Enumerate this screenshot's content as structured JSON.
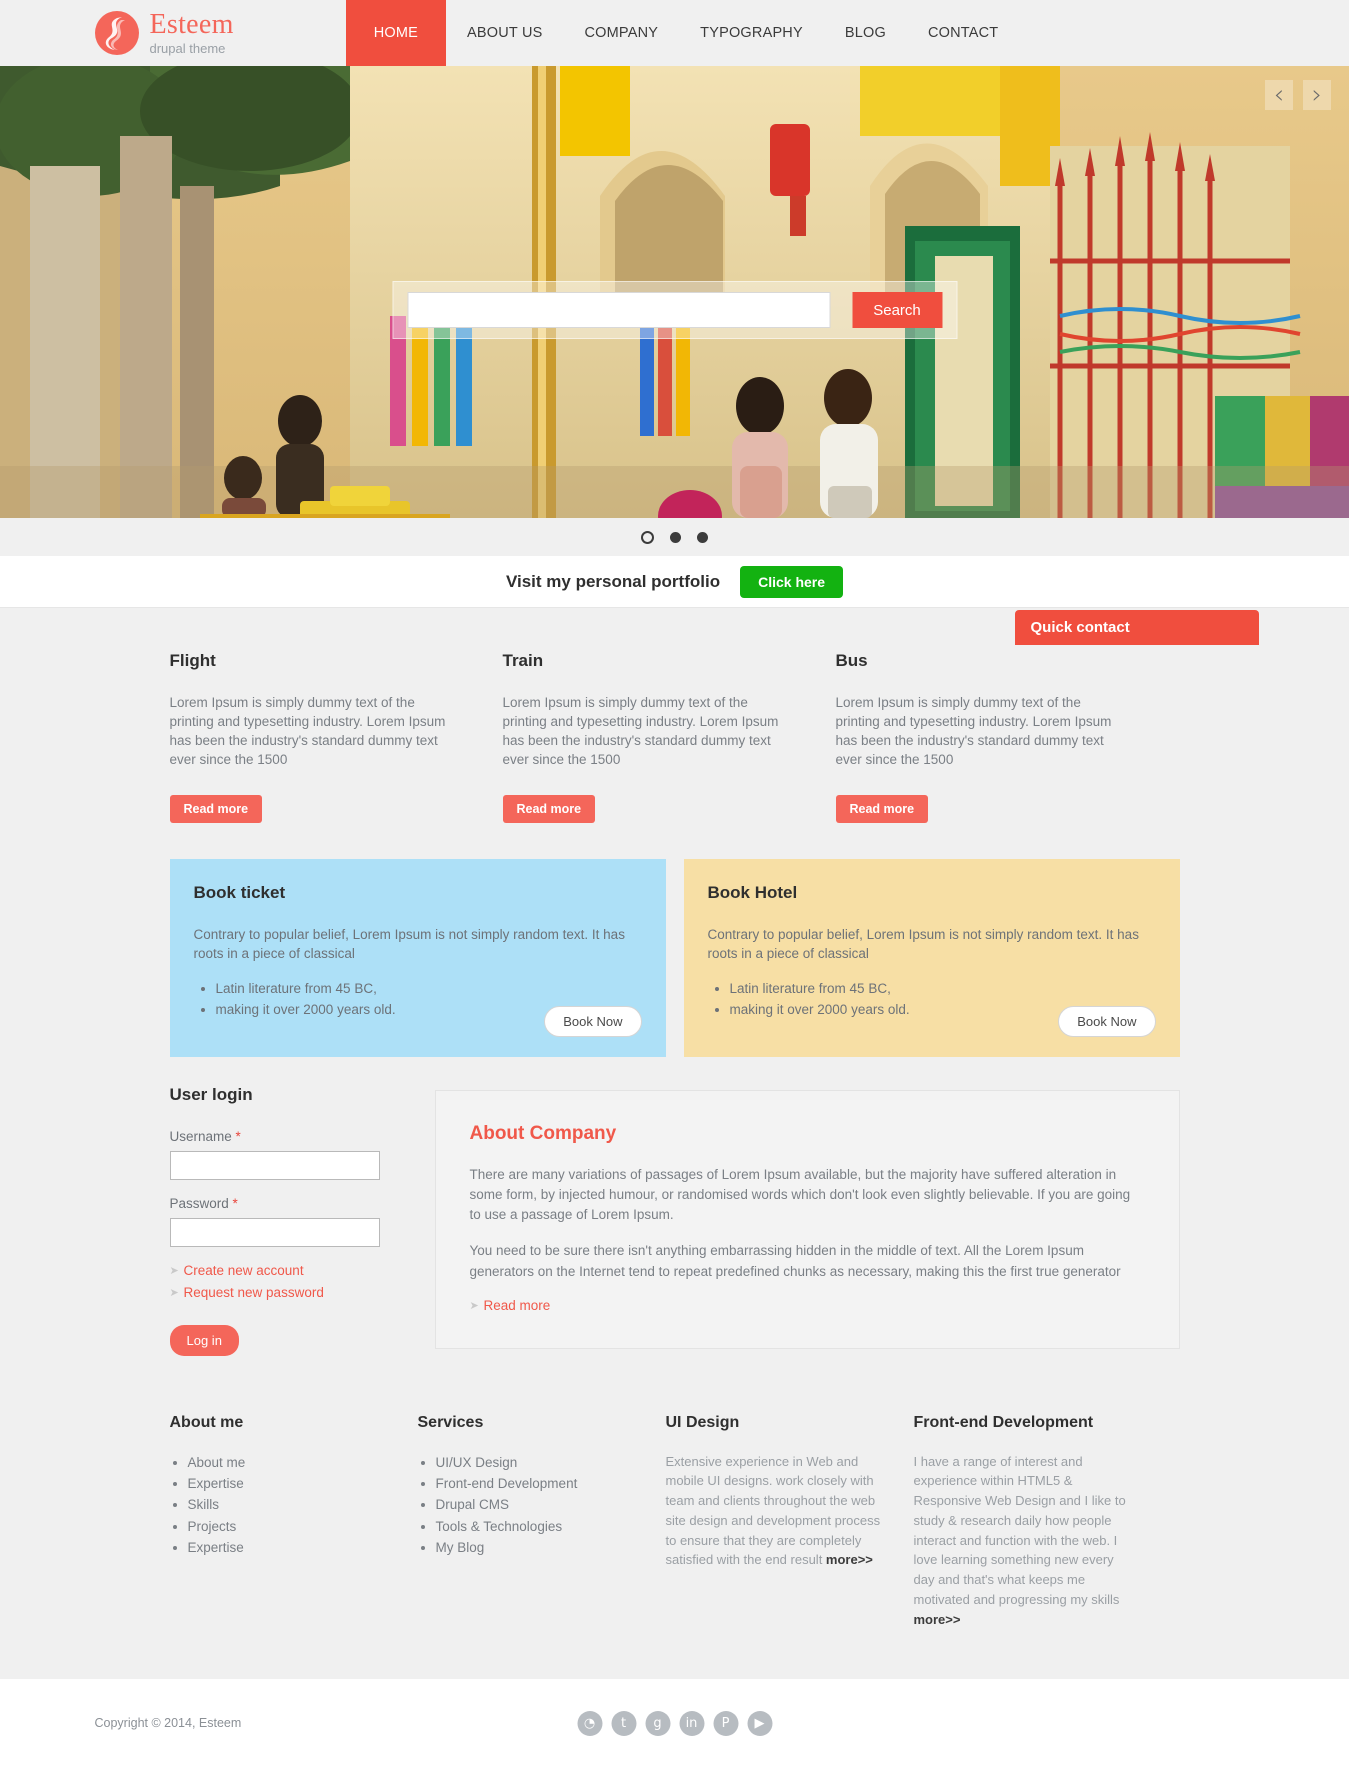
{
  "header": {
    "brand_name": "Esteem",
    "brand_sub": "drupal theme",
    "nav": [
      {
        "label": "HOME",
        "active": true
      },
      {
        "label": "ABOUT US",
        "active": false
      },
      {
        "label": "COMPANY",
        "active": false
      },
      {
        "label": "TYPOGRAPHY",
        "active": false
      },
      {
        "label": "BLOG",
        "active": false
      },
      {
        "label": "CONTACT",
        "active": false
      }
    ]
  },
  "slider": {
    "prev_glyph": "‹",
    "next_glyph": "›",
    "search_value": "",
    "search_placeholder": "",
    "search_button": "Search",
    "dots": [
      {
        "active": true
      },
      {
        "active": false
      },
      {
        "active": false
      }
    ]
  },
  "portfolio": {
    "text": "Visit my personal portfolio",
    "button": "Click here",
    "button_color": "#13b211"
  },
  "quick_contact": {
    "label": "Quick contact",
    "color": "#f04e3e"
  },
  "services": [
    {
      "title": "Flight",
      "body": "Lorem Ipsum is simply dummy text of the printing and typesetting industry. Lorem Ipsum has been the industry's standard dummy text ever since the 1500",
      "button": "Read more"
    },
    {
      "title": "Train",
      "body": "Lorem Ipsum is simply dummy text of the printing and typesetting industry. Lorem Ipsum has been the industry's standard dummy text ever since the 1500",
      "button": "Read more"
    },
    {
      "title": "Bus",
      "body": "Lorem Ipsum is simply dummy text of the printing and typesetting industry. Lorem Ipsum has been the industry's standard dummy text ever since the 1500",
      "button": "Read more"
    }
  ],
  "panels": [
    {
      "title": "Book ticket",
      "body": "Contrary to popular belief, Lorem Ipsum is not simply random text. It has roots in a piece of classical",
      "items": [
        "Latin literature from 45 BC,",
        "making it over 2000 years old."
      ],
      "button": "Book Now",
      "bg": "#ade0f7"
    },
    {
      "title": "Book Hotel",
      "body": "Contrary to popular belief, Lorem Ipsum is not simply random text. It has roots in a piece of classical",
      "items": [
        "Latin literature from 45 BC,",
        "making it over 2000 years old."
      ],
      "button": "Book Now",
      "bg": "#f7dfa5"
    }
  ],
  "login": {
    "title": "User login",
    "username_label": "Username",
    "username_value": "",
    "password_label": "Password",
    "password_value": "",
    "required_mark": "*",
    "create_account": "Create new account",
    "request_password": "Request new password",
    "submit": "Log in"
  },
  "about": {
    "title": "About Company",
    "paragraph1": "There are many variations of passages of Lorem Ipsum available, but the majority have suffered alteration in some form, by injected humour, or randomised words which don't look even slightly believable. If you are going to use a passage of Lorem Ipsum.",
    "paragraph2": "You need to be sure there isn't anything embarrassing hidden in the middle of text. All the Lorem Ipsum generators on the Internet tend to repeat predefined chunks as necessary, making this the first true generator",
    "read_more": "Read more"
  },
  "footer_columns": [
    {
      "title": "About me",
      "type": "list",
      "items": [
        "About me",
        "Expertise",
        "Skills",
        "Projects",
        "Expertise"
      ]
    },
    {
      "title": "Services",
      "type": "list",
      "items": [
        "UI/UX Design",
        "Front-end Development",
        "Drupal CMS",
        "Tools & Technologies",
        "My Blog"
      ]
    },
    {
      "title": "UI Design",
      "type": "text",
      "text": "Extensive experience in Web and mobile UI designs. work closely with team and clients throughout the web site design and development process to ensure that they are completely satisfied with the end result ",
      "more": "more>>"
    },
    {
      "title": "Front-end Development",
      "type": "text",
      "text": "I have a range of interest and experience within HTML5 & Responsive Web Design and I like to study & research daily how people interact and function with the web. I love learning something new every day and that's what keeps me motivated and progressing my skills ",
      "more": "more>>"
    }
  ],
  "bottom": {
    "copyright": "Copyright © 2014, Esteem",
    "socials": [
      {
        "name": "rss-icon",
        "glyph": "◔"
      },
      {
        "name": "twitter-icon",
        "glyph": "t"
      },
      {
        "name": "google-plus-icon",
        "glyph": "g"
      },
      {
        "name": "linkedin-icon",
        "glyph": "in"
      },
      {
        "name": "pinterest-icon",
        "glyph": "P"
      },
      {
        "name": "youtube-icon",
        "glyph": "▶"
      }
    ]
  }
}
